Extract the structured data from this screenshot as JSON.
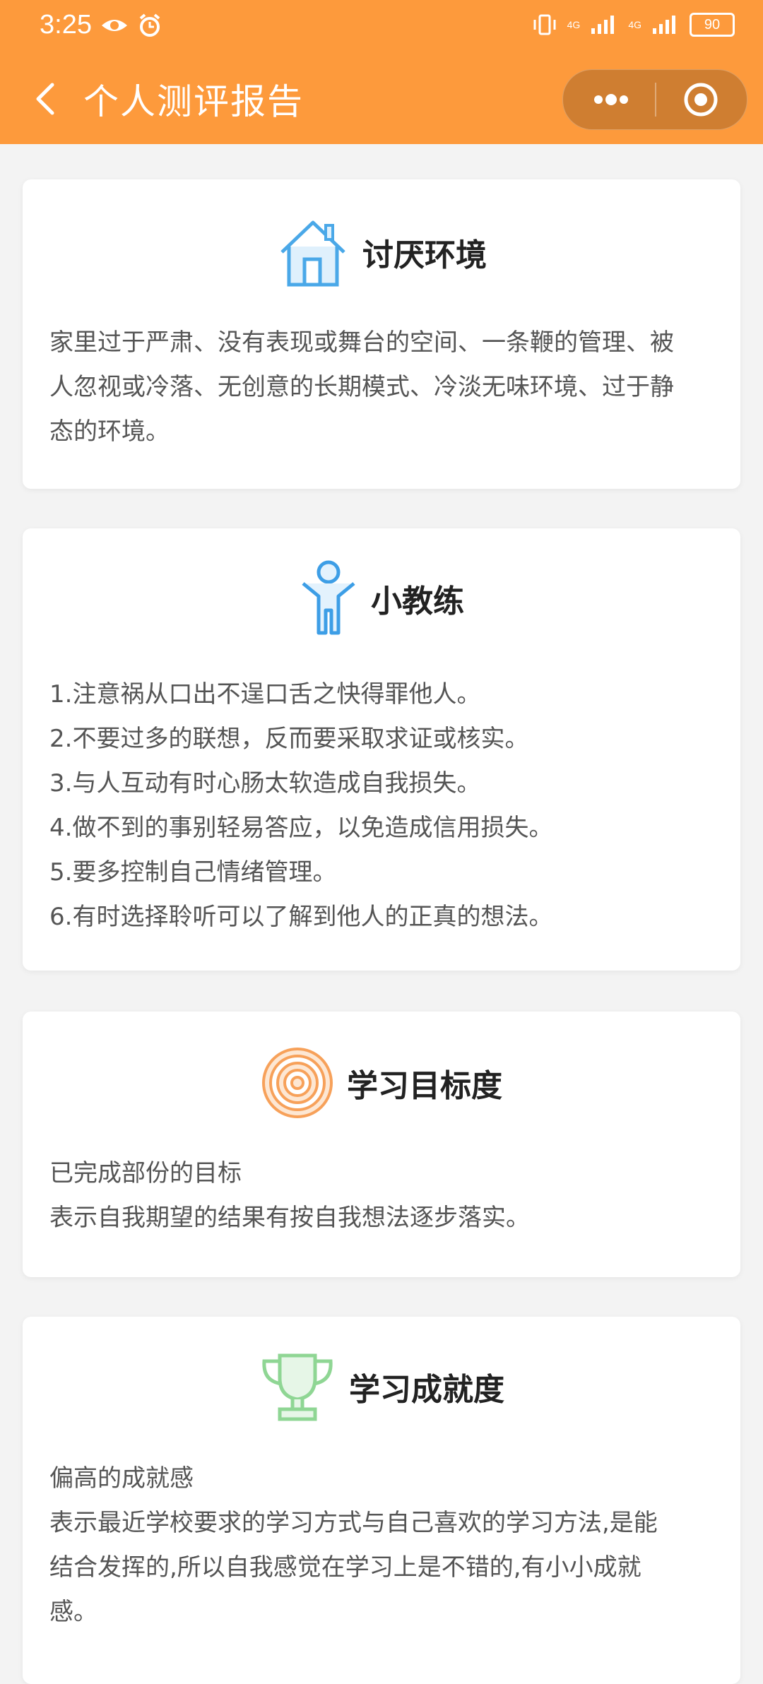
{
  "status": {
    "time": "3:25",
    "battery": "90",
    "net1": "4G",
    "net2": "4G"
  },
  "nav": {
    "title": "个人测评报告"
  },
  "icons": {
    "accent": "#fd9a3c",
    "house": "#4aa8e8",
    "kid": "#3d9ee6",
    "target": "#f7a15a",
    "trophy": "#8fd694"
  },
  "cards": [
    {
      "title": "讨厌环境",
      "icon": "house-icon",
      "body_lines": [
        "家里过于严肃、没有表现或舞台的空间、一条鞭的管理、被",
        "人忽视或冷落、无创意的长期模式、冷淡无味环境、过于静",
        "态的环境。"
      ]
    },
    {
      "title": "小教练",
      "icon": "person-icon",
      "body_lines": [
        "1.注意祸从口出不逞口舌之快得罪他人。",
        "2.不要过多的联想，反而要采取求证或核实。",
        "3.与人互动有时心肠太软造成自我损失。",
        "4.做不到的事别轻易答应，以免造成信用损失。",
        "5.要多控制自己情绪管理。",
        "6.有时选择聆听可以了解到他人的正真的想法。"
      ]
    },
    {
      "title": "学习目标度",
      "icon": "target-icon",
      "body_lines": [
        "已完成部份的目标",
        "表示自我期望的结果有按自我想法逐步落实。"
      ]
    },
    {
      "title": "学习成就度",
      "icon": "trophy-icon",
      "body_lines": [
        "偏高的成就感",
        "表示最近学校要求的学习方式与自己喜欢的学习方法,是能",
        "结合发挥的,所以自我感觉在学习上是不错的,有小小成就",
        "感。"
      ]
    }
  ]
}
